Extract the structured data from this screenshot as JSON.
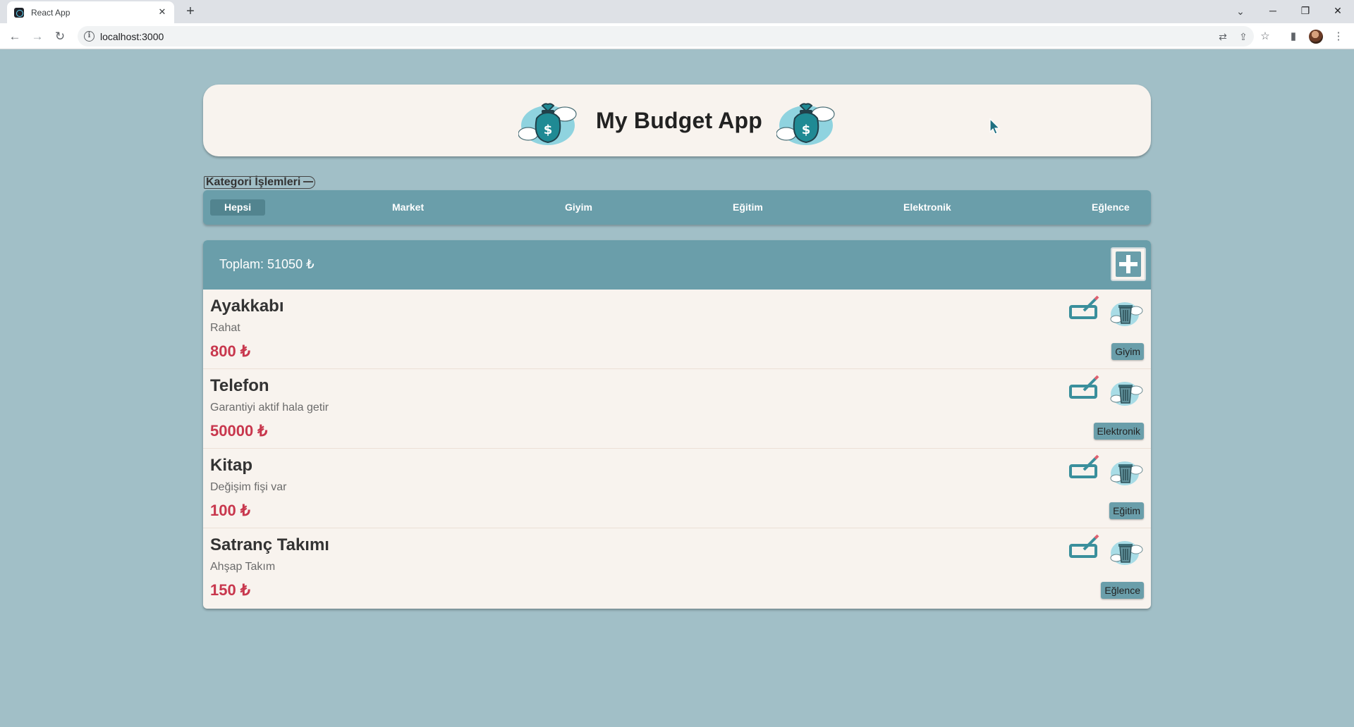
{
  "browser": {
    "tab_title": "React App",
    "tab_close": "✕",
    "new_tab": "+",
    "url": "localhost:3000",
    "window_controls": {
      "minimize": "─",
      "maximize": "❐",
      "close": "✕"
    }
  },
  "header": {
    "title": "My Budget App",
    "icon": "money-bag-icon"
  },
  "category_toggle": {
    "label": "Kategori İşlemleri"
  },
  "categories": [
    {
      "label": "Hepsi",
      "active": true
    },
    {
      "label": "Market",
      "active": false
    },
    {
      "label": "Giyim",
      "active": false
    },
    {
      "label": "Eğitim",
      "active": false
    },
    {
      "label": "Elektronik",
      "active": false
    },
    {
      "label": "Eğlence",
      "active": false
    }
  ],
  "summary": {
    "total_label": "Toplam: 51050 ₺"
  },
  "items": [
    {
      "name": "Ayakkabı",
      "description": "Rahat",
      "amount": "800 ₺",
      "category": "Giyim"
    },
    {
      "name": "Telefon",
      "description": "Garantiyi aktif hala getir",
      "amount": "50000 ₺",
      "category": "Elektronik"
    },
    {
      "name": "Kitap",
      "description": "Değişim fişi var",
      "amount": "100 ₺",
      "category": "Eğitim"
    },
    {
      "name": "Satranç Takımı",
      "description": "Ahşap Takım",
      "amount": "150 ₺",
      "category": "Eğlence"
    }
  ],
  "colors": {
    "page_background": "#a1bfc7",
    "card_background": "#f8f3ee",
    "accent_teal": "#6a9eaa",
    "amount_red": "#c8374d"
  }
}
